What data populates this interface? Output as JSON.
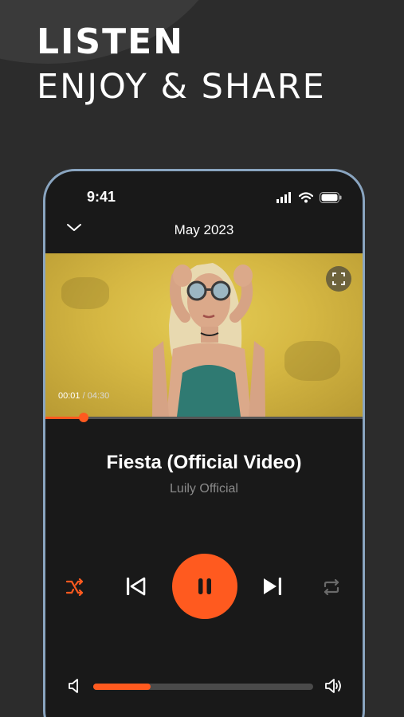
{
  "headline": {
    "line1": "LISTEN",
    "line2": "ENJOY & SHARE"
  },
  "status_bar": {
    "time": "9:41"
  },
  "top_bar": {
    "title": "May 2023"
  },
  "video": {
    "elapsed": "00:01",
    "total": "/ 04:30",
    "progress_fraction": 0.004
  },
  "track": {
    "title": "Fiesta (Official Video)",
    "artist": "Luily Official"
  },
  "volume": {
    "level_fraction": 0.26
  },
  "colors": {
    "accent": "#ff5a1f",
    "background": "#2c2c2c",
    "phone_bg": "#191919",
    "phone_frame": "#8aa5c0",
    "artist_text": "#8a8a8a"
  },
  "icons": [
    "chevron-down-icon",
    "signal-icon",
    "wifi-icon",
    "battery-icon",
    "expand-icon",
    "shuffle-icon",
    "previous-icon",
    "pause-icon",
    "next-icon",
    "repeat-icon",
    "volume-low-icon",
    "volume-high-icon"
  ]
}
